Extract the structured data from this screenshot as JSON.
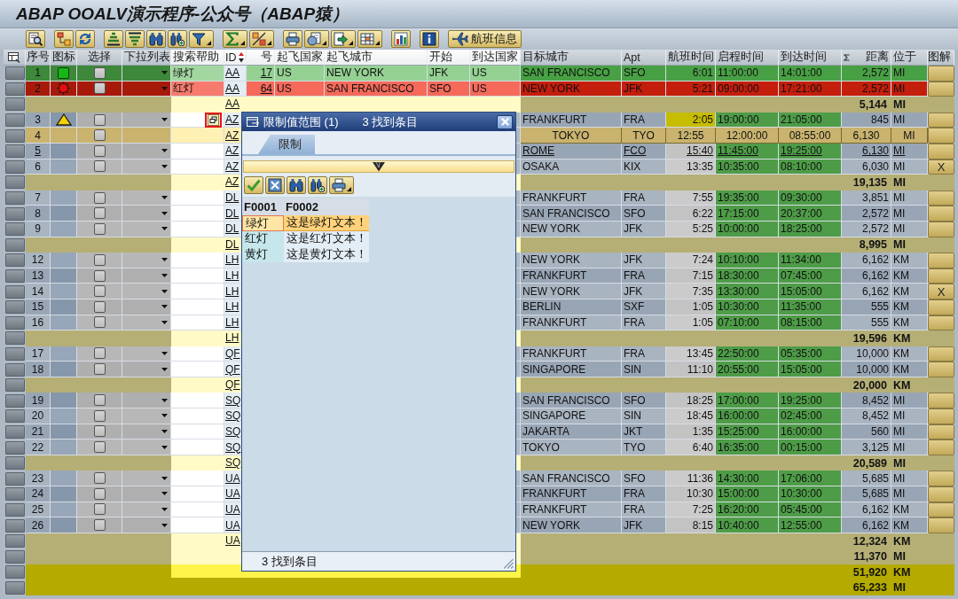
{
  "window": {
    "title": "ABAP OOALV演示程序-公众号（ABAP猿）"
  },
  "toolbar": {
    "custom_button": {
      "label": "航班信息"
    }
  },
  "grid": {
    "columns": [
      {
        "label": "序号",
        "sorted": false,
        "summed": false
      },
      {
        "label": "图标",
        "sorted": false,
        "summed": false
      },
      {
        "label": "选择",
        "sorted": false,
        "summed": false
      },
      {
        "label": "下拉列表",
        "sorted": false,
        "summed": false
      },
      {
        "label": "搜索帮助",
        "sorted": false,
        "summed": false
      },
      {
        "label": "ID",
        "sorted": true,
        "summed": false
      },
      {
        "label": "号",
        "sorted": false,
        "summed": false
      },
      {
        "label": "起飞国家",
        "sorted": false,
        "summed": false
      },
      {
        "label": "起飞城市",
        "sorted": false,
        "summed": false
      },
      {
        "label": "开始",
        "sorted": false,
        "summed": false
      },
      {
        "label": "到达国家",
        "sorted": false,
        "summed": false
      },
      {
        "label": "目标城市",
        "sorted": false,
        "summed": false
      },
      {
        "label": "Apt",
        "sorted": false,
        "summed": false
      },
      {
        "label": "航班时间",
        "sorted": false,
        "summed": false
      },
      {
        "label": "启程时间",
        "sorted": false,
        "summed": false
      },
      {
        "label": "到达时间",
        "sorted": false,
        "summed": false
      },
      {
        "label": "距离",
        "sorted": false,
        "summed": true
      },
      {
        "label": "位于",
        "sorted": false,
        "summed": false
      },
      {
        "label": "图解",
        "sorted": false,
        "summed": false
      }
    ],
    "rows": [
      {
        "kind": "data",
        "seq": "1",
        "color": "#48a044",
        "status": {
          "kind": "success"
        },
        "checked": false,
        "selected": false,
        "hotspot": false,
        "focused": false,
        "search_help": "绿灯",
        "id": "AA",
        "number": "17",
        "from_country": "US",
        "from_city": "NEW YORK",
        "from_apt": "JFK",
        "to_country": "US",
        "to_city": "SAN FRANCISCO",
        "to_apt": "SFO",
        "flight_time": "6:01",
        "dep_time": "11:00:00",
        "arr_time": "14:01:00",
        "distance": "2,572",
        "unit": "MI"
      },
      {
        "kind": "data",
        "seq": "2",
        "color": "#c41e0c",
        "status": {
          "kind": "error"
        },
        "checked": false,
        "selected": false,
        "hotspot": false,
        "focused": false,
        "search_help": "红灯",
        "id": "AA",
        "number": "64",
        "from_country": "US",
        "from_city": "SAN FRANCISCO",
        "from_apt": "SFO",
        "to_country": "US",
        "to_city": "NEW YORK",
        "to_apt": "JFK",
        "flight_time": "5:21",
        "dep_time": "09:00:00",
        "arr_time": "17:21:00",
        "distance": "2,572",
        "unit": "MI"
      },
      {
        "kind": "subtotal",
        "id": "AA",
        "totals": [
          {
            "distance": "5,144",
            "unit": "MI"
          }
        ]
      },
      {
        "kind": "data",
        "seq": "3",
        "status": {
          "kind": "warning"
        },
        "checked": false,
        "selected": false,
        "hotspot": false,
        "focused": true,
        "id": "AZ",
        "to_city": "FRANKFURT",
        "to_apt": "FRA",
        "flight_time": "2:05",
        "flight_time_highlight": {
          "color": "#c6bc00"
        },
        "dep_time": "19:00:00",
        "arr_time": "21:05:00",
        "distance": "845",
        "unit": "MI"
      },
      {
        "kind": "data",
        "seq": "4",
        "checked": false,
        "selected": true,
        "hotspot": false,
        "focused": false,
        "id": "AZ",
        "to_city": "TOKYO",
        "to_apt": "TYO",
        "flight_time": "12:55",
        "dep_time": "12:00:00",
        "arr_time": "08:55:00",
        "distance": "6,130",
        "unit": "MI"
      },
      {
        "kind": "data",
        "seq": "5",
        "checked": false,
        "selected": false,
        "hotspot": true,
        "focused": false,
        "id": "AZ",
        "to_city": "ROME",
        "to_apt": "FCO",
        "flight_time": "15:40",
        "dep_time": "11:45:00",
        "arr_time": "19:25:00",
        "distance": "6,130",
        "unit": "MI"
      },
      {
        "kind": "data",
        "seq": "6",
        "checked": false,
        "selected": false,
        "hotspot": false,
        "focused": false,
        "id": "AZ",
        "to_city": "OSAKA",
        "to_apt": "KIX",
        "flight_time": "13:35",
        "dep_time": "10:35:00",
        "arr_time": "08:10:00",
        "distance": "6,030",
        "unit": "MI",
        "legend": "X"
      },
      {
        "kind": "subtotal",
        "id": "AZ",
        "totals": [
          {
            "distance": "19,135",
            "unit": "MI"
          }
        ]
      },
      {
        "kind": "data",
        "seq": "7",
        "checked": false,
        "selected": false,
        "hotspot": false,
        "focused": false,
        "id": "DL",
        "to_city": "FRANKFURT",
        "to_apt": "FRA",
        "flight_time": "7:55",
        "dep_time": "19:35:00",
        "arr_time": "09:30:00",
        "distance": "3,851",
        "unit": "MI"
      },
      {
        "kind": "data",
        "seq": "8",
        "checked": false,
        "selected": false,
        "hotspot": false,
        "focused": false,
        "id": "DL",
        "to_city": "SAN FRANCISCO",
        "to_apt": "SFO",
        "flight_time": "6:22",
        "dep_time": "17:15:00",
        "arr_time": "20:37:00",
        "distance": "2,572",
        "unit": "MI"
      },
      {
        "kind": "data",
        "seq": "9",
        "checked": false,
        "selected": false,
        "hotspot": false,
        "focused": false,
        "id": "DL",
        "to_city": "NEW YORK",
        "to_apt": "JFK",
        "flight_time": "5:25",
        "dep_time": "10:00:00",
        "arr_time": "18:25:00",
        "distance": "2,572",
        "unit": "MI"
      },
      {
        "kind": "subtotal",
        "id": "DL",
        "totals": [
          {
            "distance": "8,995",
            "unit": "MI"
          }
        ]
      },
      {
        "kind": "data",
        "seq": "12",
        "checked": false,
        "selected": false,
        "hotspot": false,
        "focused": false,
        "id": "LH",
        "to_city": "NEW YORK",
        "to_apt": "JFK",
        "flight_time": "7:24",
        "dep_time": "10:10:00",
        "arr_time": "11:34:00",
        "distance": "6,162",
        "unit": "KM"
      },
      {
        "kind": "data",
        "seq": "13",
        "checked": false,
        "selected": false,
        "hotspot": false,
        "focused": false,
        "id": "LH",
        "to_city": "FRANKFURT",
        "to_apt": "FRA",
        "flight_time": "7:15",
        "dep_time": "18:30:00",
        "arr_time": "07:45:00",
        "distance": "6,162",
        "unit": "KM"
      },
      {
        "kind": "data",
        "seq": "14",
        "checked": false,
        "selected": false,
        "hotspot": false,
        "focused": false,
        "id": "LH",
        "to_city": "NEW YORK",
        "to_apt": "JFK",
        "flight_time": "7:35",
        "dep_time": "13:30:00",
        "arr_time": "15:05:00",
        "distance": "6,162",
        "unit": "KM",
        "legend": "X"
      },
      {
        "kind": "data",
        "seq": "15",
        "checked": false,
        "selected": false,
        "hotspot": false,
        "focused": false,
        "id": "LH",
        "to_city": "BERLIN",
        "to_apt": "SXF",
        "flight_time": "1:05",
        "dep_time": "10:30:00",
        "arr_time": "11:35:00",
        "distance": "555",
        "unit": "KM"
      },
      {
        "kind": "data",
        "seq": "16",
        "checked": false,
        "selected": false,
        "hotspot": false,
        "focused": false,
        "id": "LH",
        "to_city": "FRANKFURT",
        "to_apt": "FRA",
        "flight_time": "1:05",
        "dep_time": "07:10:00",
        "arr_time": "08:15:00",
        "distance": "555",
        "unit": "KM"
      },
      {
        "kind": "subtotal",
        "id": "LH",
        "totals": [
          {
            "distance": "19,596",
            "unit": "KM"
          }
        ]
      },
      {
        "kind": "data",
        "seq": "17",
        "checked": false,
        "selected": false,
        "hotspot": false,
        "focused": false,
        "id": "QF",
        "to_city": "FRANKFURT",
        "to_apt": "FRA",
        "flight_time": "13:45",
        "dep_time": "22:50:00",
        "arr_time": "05:35:00",
        "distance": "10,000",
        "unit": "KM"
      },
      {
        "kind": "data",
        "seq": "18",
        "checked": false,
        "selected": false,
        "hotspot": false,
        "focused": false,
        "id": "QF",
        "to_city": "SINGAPORE",
        "to_apt": "SIN",
        "flight_time": "11:10",
        "dep_time": "20:55:00",
        "arr_time": "15:05:00",
        "distance": "10,000",
        "unit": "KM"
      },
      {
        "kind": "subtotal",
        "id": "QF",
        "totals": [
          {
            "distance": "20,000",
            "unit": "KM"
          }
        ]
      },
      {
        "kind": "data",
        "seq": "19",
        "checked": false,
        "selected": false,
        "hotspot": false,
        "focused": false,
        "id": "SQ",
        "to_city": "SAN FRANCISCO",
        "to_apt": "SFO",
        "flight_time": "18:25",
        "dep_time": "17:00:00",
        "arr_time": "19:25:00",
        "distance": "8,452",
        "unit": "MI"
      },
      {
        "kind": "data",
        "seq": "20",
        "checked": false,
        "selected": false,
        "hotspot": false,
        "focused": false,
        "id": "SQ",
        "to_city": "SINGAPORE",
        "to_apt": "SIN",
        "flight_time": "18:45",
        "dep_time": "16:00:00",
        "arr_time": "02:45:00",
        "distance": "8,452",
        "unit": "MI"
      },
      {
        "kind": "data",
        "seq": "21",
        "checked": false,
        "selected": false,
        "hotspot": false,
        "focused": false,
        "id": "SQ",
        "to_city": "JAKARTA",
        "to_apt": "JKT",
        "flight_time": "1:35",
        "dep_time": "15:25:00",
        "arr_time": "16:00:00",
        "distance": "560",
        "unit": "MI"
      },
      {
        "kind": "data",
        "seq": "22",
        "checked": false,
        "selected": false,
        "hotspot": false,
        "focused": false,
        "id": "SQ",
        "to_city": "TOKYO",
        "to_apt": "TYO",
        "flight_time": "6:40",
        "dep_time": "16:35:00",
        "arr_time": "00:15:00",
        "distance": "3,125",
        "unit": "MI"
      },
      {
        "kind": "subtotal",
        "id": "SQ",
        "totals": [
          {
            "distance": "20,589",
            "unit": "MI"
          }
        ]
      },
      {
        "kind": "data",
        "seq": "23",
        "checked": false,
        "selected": false,
        "hotspot": false,
        "focused": false,
        "id": "UA",
        "to_city": "SAN FRANCISCO",
        "to_apt": "SFO",
        "flight_time": "11:36",
        "dep_time": "14:30:00",
        "arr_time": "17:06:00",
        "distance": "5,685",
        "unit": "MI"
      },
      {
        "kind": "data",
        "seq": "24",
        "checked": false,
        "selected": false,
        "hotspot": false,
        "focused": false,
        "id": "UA",
        "to_city": "FRANKFURT",
        "to_apt": "FRA",
        "flight_time": "10:30",
        "dep_time": "15:00:00",
        "arr_time": "10:30:00",
        "distance": "5,685",
        "unit": "MI"
      },
      {
        "kind": "data",
        "seq": "25",
        "checked": false,
        "selected": false,
        "hotspot": false,
        "focused": false,
        "id": "UA",
        "to_city": "FRANKFURT",
        "to_apt": "FRA",
        "flight_time": "7:25",
        "dep_time": "16:20:00",
        "arr_time": "05:45:00",
        "distance": "6,162",
        "unit": "KM"
      },
      {
        "kind": "data",
        "seq": "26",
        "checked": false,
        "selected": false,
        "hotspot": false,
        "focused": false,
        "id": "UA",
        "to_city": "NEW YORK",
        "to_apt": "JFK",
        "flight_time": "8:15",
        "dep_time": "10:40:00",
        "arr_time": "12:55:00",
        "distance": "6,162",
        "unit": "KM"
      },
      {
        "kind": "subtotal",
        "id": "UA",
        "totals": [
          {
            "distance": "12,324",
            "unit": "KM"
          },
          {
            "distance": "11,370",
            "unit": "MI"
          }
        ]
      },
      {
        "kind": "total",
        "totals": [
          {
            "distance": "51,920",
            "unit": "KM"
          },
          {
            "distance": "65,233",
            "unit": "MI"
          }
        ]
      }
    ]
  },
  "popup": {
    "title": "限制值范围 (1)",
    "count": "3 找到条目",
    "tabs": [
      {
        "label": "限制",
        "selected": true
      }
    ],
    "table": {
      "columns": [
        "F0001",
        "F0002"
      ],
      "rows": [
        {
          "key": "绿灯",
          "text": "这是绿灯文本！",
          "selected": true
        },
        {
          "key": "红灯",
          "text": "这是红灯文本！",
          "selected": false
        },
        {
          "key": "黄灯",
          "text": "这是黄灯文本！",
          "selected": false
        }
      ]
    },
    "status": "3 找到条目"
  }
}
